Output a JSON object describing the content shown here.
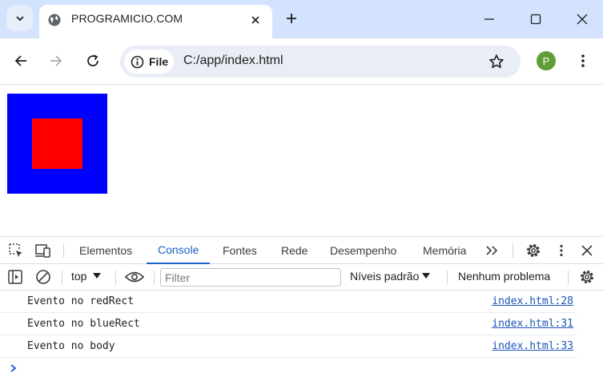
{
  "browser": {
    "tab": {
      "title": "PROGRAMICIO.COM",
      "favicon": "globe-icon"
    },
    "omnibox": {
      "site_chip": "File",
      "url": "C:/app/index.html"
    },
    "profile_initial": "P",
    "colors": {
      "tabstrip": "#d3e3fd",
      "omnibox": "#e9eef6",
      "avatar": "#5f9e37"
    }
  },
  "page": {
    "outer_rect_color": "#0000ff",
    "inner_rect_color": "#ff0000"
  },
  "devtools": {
    "tabs": [
      {
        "label": "Elementos",
        "active": false
      },
      {
        "label": "Console",
        "active": true
      },
      {
        "label": "Fontes",
        "active": false
      },
      {
        "label": "Rede",
        "active": false
      },
      {
        "label": "Desempenho",
        "active": false
      },
      {
        "label": "Memória",
        "active": false
      }
    ],
    "more_tabs": ">>",
    "filterbar": {
      "context": "top",
      "filter_placeholder": "Filter",
      "levels": "Níveis padrão",
      "issues": "Nenhum problema"
    },
    "console_messages": [
      {
        "text": "Evento no redRect",
        "source": "index.html:28"
      },
      {
        "text": "Evento no blueRect",
        "source": "index.html:31"
      },
      {
        "text": "Evento no body",
        "source": "index.html:33"
      }
    ],
    "accent_color": "#1a62c9"
  }
}
